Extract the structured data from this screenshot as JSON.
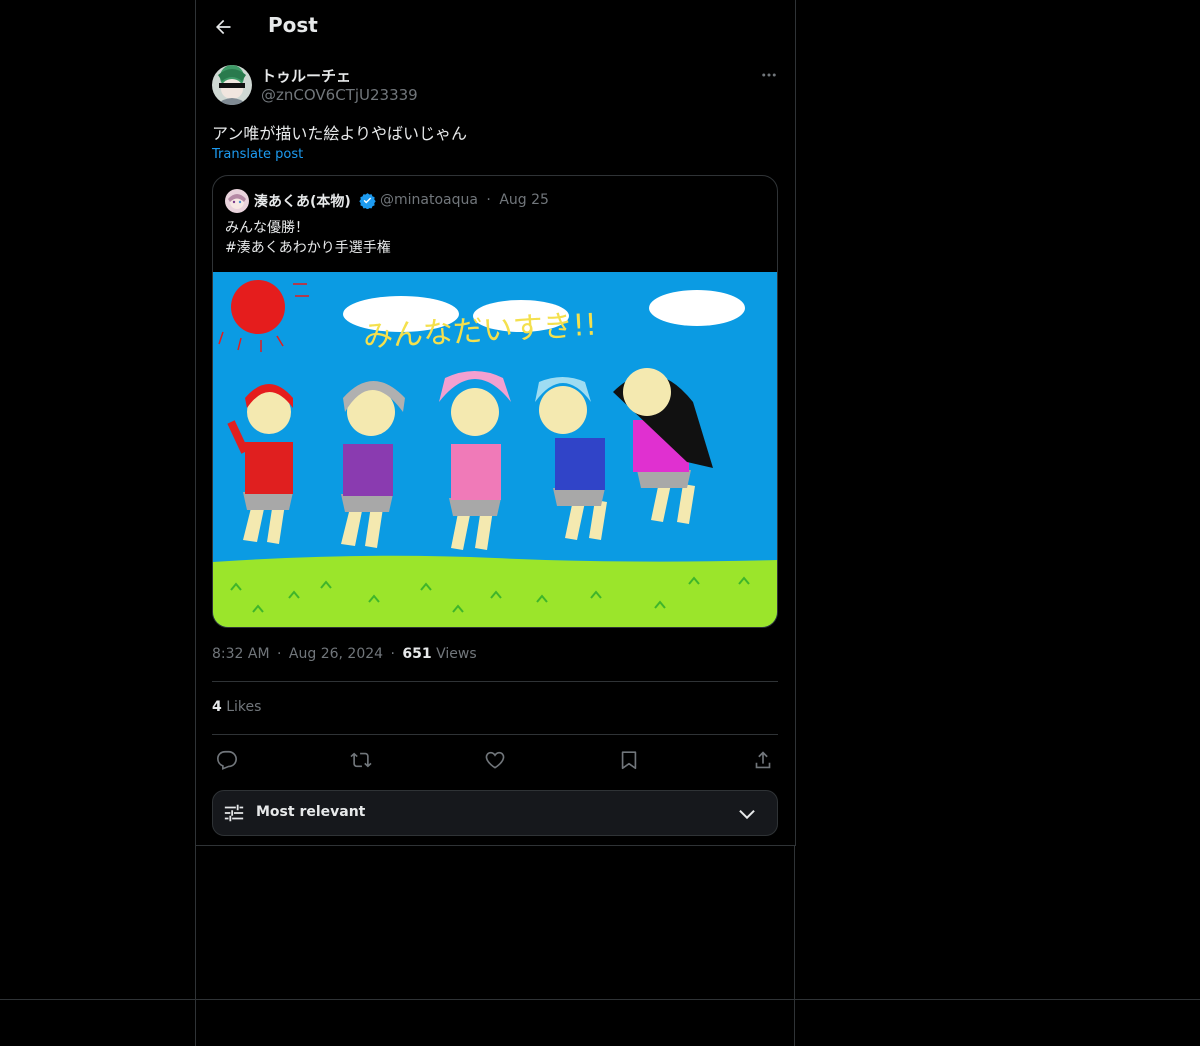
{
  "header": {
    "title": "Post"
  },
  "post": {
    "display_name": "トゥルーチェ",
    "handle": "@znCOV6CTjU23339",
    "text": "アン唯が描いた絵よりやばいじゃん",
    "translate_label": "Translate post",
    "time": "8:32 AM",
    "date": "Aug 26, 2024",
    "views_count": "651",
    "views_label": "Views",
    "likes_count": "4",
    "likes_label": "Likes",
    "dot": "·"
  },
  "quote": {
    "display_name": "湊あくあ(本物)",
    "handle": "@minatoaqua",
    "date": "Aug 25",
    "text_line1": "みんな優勝！",
    "text_line2": "#湊あくあわかり手選手権",
    "image_caption": "みんなだいすき!!"
  },
  "sort": {
    "label": "Most relevant"
  },
  "colors": {
    "accent": "#1d9bf0",
    "sky": "#0b9be3",
    "grass": "#9be52b"
  },
  "icons": [
    "back-arrow-icon",
    "more-icon",
    "verified-icon",
    "reply-icon",
    "repost-icon",
    "like-icon",
    "bookmark-icon",
    "share-icon",
    "sliders-icon",
    "chevron-down-icon"
  ]
}
